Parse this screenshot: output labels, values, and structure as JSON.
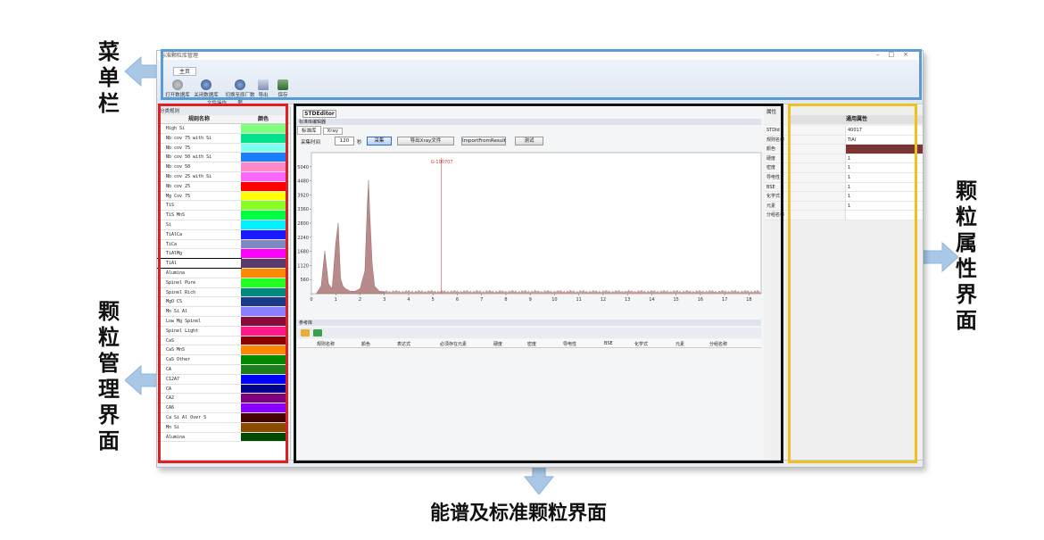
{
  "callouts": {
    "menu_bar": "菜单栏",
    "particle_management": "颗粒管理界面",
    "particle_properties": "颗粒属性界面",
    "spectrum_standard": "能谱及标准颗粒界面"
  },
  "frame_colors": {
    "menu": "#5a9bd5",
    "management": "#e02020",
    "spectrum": "#111111",
    "properties": "#f0c020",
    "arrow": "#a9c8e8"
  },
  "window": {
    "title": "标准颗粒库管理",
    "controls": [
      "–",
      "□",
      "×"
    ]
  },
  "ribbon": {
    "tab": "主页",
    "buttons": [
      {
        "label": "打开数据库",
        "icon": "refresh-icon"
      },
      {
        "label": "关闭数据库",
        "icon": "refresh-icon"
      },
      {
        "label": "切换至原厂数据",
        "icon": "refresh-icon"
      },
      {
        "label": "导出",
        "icon": "document-icon"
      },
      {
        "label": "保存",
        "icon": "save-icon"
      }
    ],
    "group_label": "文件操作"
  },
  "left_panel": {
    "caption": "分类规则",
    "col_name": "规则名称",
    "col_color": "颜色",
    "rows": [
      {
        "name": "High Si",
        "color": "#7fff7f"
      },
      {
        "name": "Nb cov 75 with Si",
        "color": "#00e28a"
      },
      {
        "name": "Nb cov 75",
        "color": "#7ffff0"
      },
      {
        "name": "Nb cov 50 with Si",
        "color": "#1a7fff"
      },
      {
        "name": "Nb cov 50",
        "color": "#ff88c8"
      },
      {
        "name": "Nb cov 25 with Si",
        "color": "#ff66ff"
      },
      {
        "name": "Nb cov 25",
        "color": "#ff0000"
      },
      {
        "name": "Mg Cov 75",
        "color": "#ffff00"
      },
      {
        "name": "TiS",
        "color": "#88ff22"
      },
      {
        "name": "TiS MnS",
        "color": "#00ff44"
      },
      {
        "name": "Si",
        "color": "#00f0ff"
      },
      {
        "name": "TiAlCa",
        "color": "#1a1aff"
      },
      {
        "name": "TiCa",
        "color": "#7f88c0"
      },
      {
        "name": "TiAlMg",
        "color": "#ff00ff"
      },
      {
        "name": "TiAl",
        "color": "#5a3a6a"
      },
      {
        "name": "Alumina",
        "color": "#ff8a00"
      },
      {
        "name": "Spinel Pure",
        "color": "#22ff22"
      },
      {
        "name": "Spinel Rich",
        "color": "#008a7f"
      },
      {
        "name": "MgO CS",
        "color": "#1a3a8a"
      },
      {
        "name": "Mn Si Al",
        "color": "#8a7fff"
      },
      {
        "name": "Low Mg Spinel",
        "color": "#8a0a3a"
      },
      {
        "name": "Spinel Light",
        "color": "#ff1a8a"
      },
      {
        "name": "CaS",
        "color": "#8a0000"
      },
      {
        "name": "CaS MnS",
        "color": "#ff8800"
      },
      {
        "name": "CaS Other",
        "color": "#008800"
      },
      {
        "name": "CA",
        "color": "#1a7f1a"
      },
      {
        "name": "C12A7",
        "color": "#0000ff"
      },
      {
        "name": "CA",
        "color": "#00008a"
      },
      {
        "name": "CA2",
        "color": "#7f007f"
      },
      {
        "name": "CA6",
        "color": "#8800ff"
      },
      {
        "name": "Ca Si Al Over S",
        "color": "#4a0000"
      },
      {
        "name": "Mn Si",
        "color": "#8a4a00"
      },
      {
        "name": "Alumina",
        "color": "#004a00"
      }
    ]
  },
  "center": {
    "doc_tab": "STDEditor",
    "sub_caption": "标准库编辑器",
    "sub_tabs": [
      "标准库",
      "Xray"
    ],
    "acq_label": "采集时间",
    "acq_value": "120",
    "acq_unit": "秒",
    "btn_collect": "采集",
    "btn_export": "导出Xray文件",
    "btn_import": "ImportFromResult",
    "btn_test": "测试",
    "ref_caption": "参考库",
    "ref_columns": [
      "规则名称",
      "颜色",
      "表达式",
      "必须存在元素",
      "硬度",
      "密度",
      "导电性",
      "BSE",
      "化学式",
      "元素",
      "分组名称"
    ]
  },
  "chart_data": {
    "type": "line",
    "title": "",
    "xlabel": "",
    "ylabel": "",
    "xlim": [
      0,
      18.5
    ],
    "ylim": [
      0,
      5600
    ],
    "x_ticks": [
      0,
      1,
      2,
      3,
      4,
      5,
      6,
      7,
      8,
      9,
      10,
      11,
      12,
      13,
      14,
      15,
      16,
      17,
      18
    ],
    "y_ticks": [
      560,
      1120,
      1680,
      2240,
      2800,
      3360,
      3920,
      4480,
      5040
    ],
    "marker": {
      "x": 5.35,
      "label": "G-100707"
    },
    "series": [
      {
        "x": [
          0.2,
          0.4,
          0.55,
          0.7,
          0.85,
          1.0,
          1.1,
          1.2,
          1.3,
          1.4,
          1.5,
          1.6,
          1.8,
          2.0,
          2.2,
          2.3,
          2.35,
          2.4,
          2.5,
          2.6,
          2.8,
          3.0
        ],
        "y": [
          0,
          300,
          1700,
          400,
          200,
          2000,
          2800,
          600,
          300,
          200,
          150,
          100,
          100,
          200,
          900,
          3600,
          4500,
          3200,
          1200,
          300,
          100,
          80
        ]
      }
    ]
  },
  "right_panel": {
    "caption": "属性",
    "header": "通用属性",
    "rows": [
      {
        "key": "STDId",
        "value": "40017"
      },
      {
        "key": "规则名称",
        "value": "TiAl"
      },
      {
        "key": "颜色",
        "value": "",
        "color": "#7a3535"
      },
      {
        "key": "硬度",
        "value": "1"
      },
      {
        "key": "密度",
        "value": "1"
      },
      {
        "key": "导电性",
        "value": "1"
      },
      {
        "key": "BSE",
        "value": "1"
      },
      {
        "key": "化学式",
        "value": "1"
      },
      {
        "key": "元素",
        "value": "1"
      },
      {
        "key": "分组名称",
        "value": ""
      }
    ]
  }
}
